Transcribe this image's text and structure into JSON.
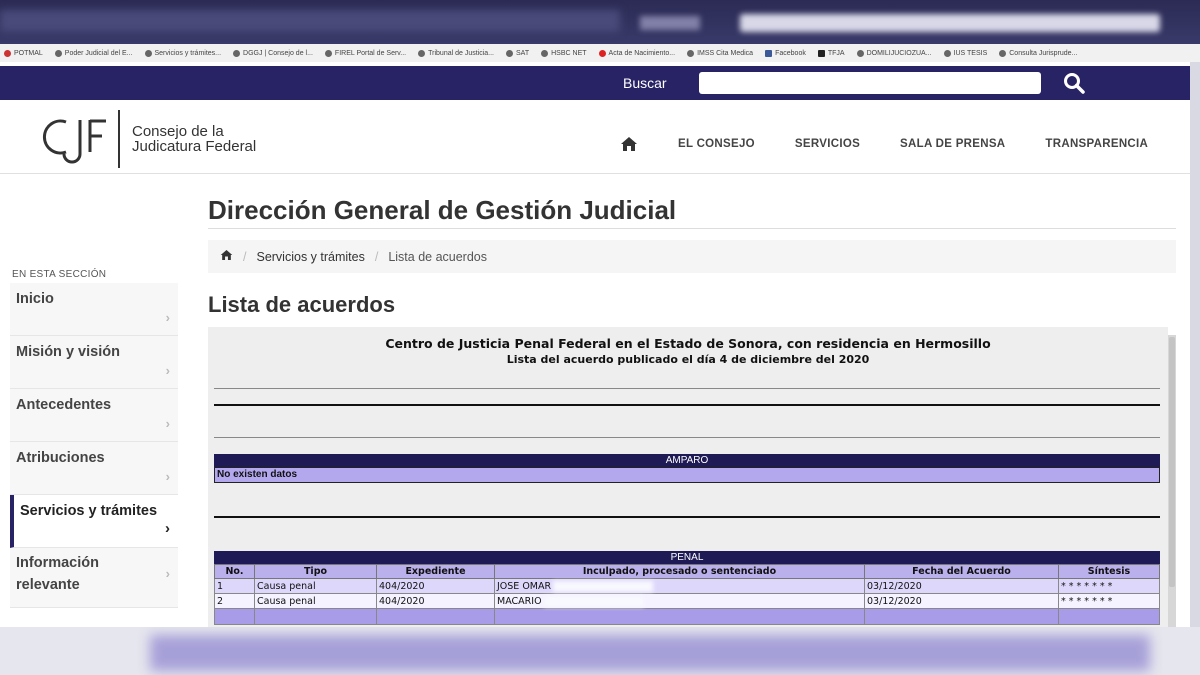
{
  "bookmarks": [
    "POTMAL",
    "Poder Judicial del E...",
    "Servicios y trámites...",
    "DGGJ | Consejo de l...",
    "FIREL Portal de Serv...",
    "Tribunal de Justicia...",
    "SAT",
    "HSBC NET",
    "Acta de Nacimiento...",
    "IMSS Cita Medica",
    "Facebook",
    "TFJA",
    "DOMILIJUCIOZUA...",
    "IUS TESIS",
    "Consulta Jurisprude..."
  ],
  "search": {
    "label": "Buscar",
    "placeholder": ""
  },
  "logo": {
    "mark": "CJF",
    "line1": "Consejo de la",
    "line2": "Judicatura Federal"
  },
  "nav": {
    "items": [
      "EL CONSEJO",
      "SERVICIOS",
      "SALA DE PRENSA",
      "TRANSPARENCIA"
    ]
  },
  "page_title": "Dirección General de Gestión Judicial",
  "breadcrumb": {
    "items": [
      "Servicios y trámites",
      "Lista de acuerdos"
    ]
  },
  "sidebar": {
    "heading": "EN ESTA SECCIÓN",
    "items": [
      {
        "label": "Inicio"
      },
      {
        "label": "Misión y visión"
      },
      {
        "label": "Antecedentes"
      },
      {
        "label": "Atribuciones"
      },
      {
        "label": "Servicios y trámites"
      },
      {
        "label_line1": "Información",
        "label_line2": "relevante"
      }
    ]
  },
  "section_title": "Lista de acuerdos",
  "document": {
    "heading": "Centro de Justicia Penal Federal en el Estado de Sonora, con residencia en Hermosillo",
    "subheading": "Lista del acuerdo publicado el día 4 de diciembre del 2020",
    "amparo": {
      "title": "AMPARO",
      "empty_text": "No existen datos"
    },
    "penal": {
      "title": "PENAL",
      "columns": [
        "No.",
        "Tipo",
        "Expediente",
        "Inculpado, procesado o sentenciado",
        "Fecha del Acuerdo",
        "Síntesis"
      ],
      "rows": [
        {
          "no": "1",
          "tipo": "Causa penal",
          "expediente": "404/2020",
          "nombre": "JOSE OMAR",
          "fecha": "03/12/2020",
          "sintesis": "* * * * * * *"
        },
        {
          "no": "2",
          "tipo": "Causa penal",
          "expediente": "404/2020",
          "nombre": "MACARIO",
          "fecha": "03/12/2020",
          "sintesis": "* * * * * * *"
        }
      ]
    }
  }
}
